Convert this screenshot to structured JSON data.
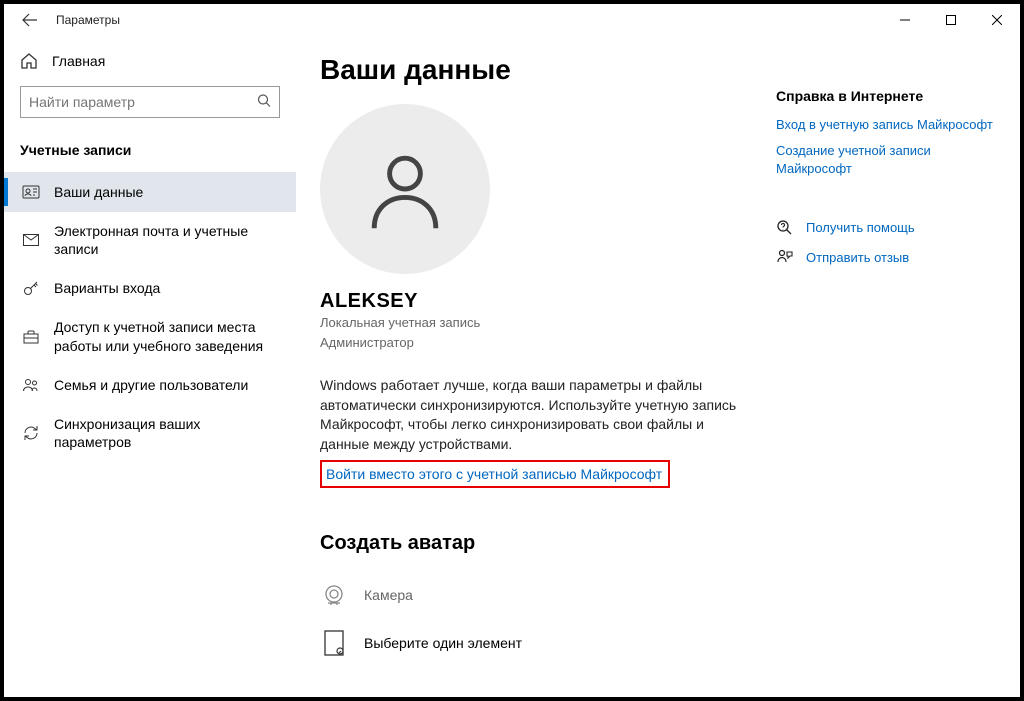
{
  "titlebar": {
    "title": "Параметры"
  },
  "sidebar": {
    "home": "Главная",
    "search_placeholder": "Найти параметр",
    "section": "Учетные записи",
    "items": [
      {
        "label": "Ваши данные"
      },
      {
        "label": "Электронная почта и учетные записи"
      },
      {
        "label": "Варианты входа"
      },
      {
        "label": "Доступ к учетной записи места работы или учебного заведения"
      },
      {
        "label": "Семья и другие пользователи"
      },
      {
        "label": "Синхронизация ваших параметров"
      }
    ]
  },
  "main": {
    "title": "Ваши данные",
    "username": "ALEKSEY",
    "acct_type": "Локальная учетная запись",
    "role": "Администратор",
    "description": "Windows работает лучше, когда ваши параметры и файлы автоматически синхронизируются. Используйте учетную запись Майкрософт, чтобы легко синхронизировать свои файлы и данные между устройствами.",
    "signin_link": "Войти вместо этого с учетной записью Майкрософт",
    "create_avatar_head": "Создать аватар",
    "camera_label": "Камера",
    "browse_label": "Выберите один элемент"
  },
  "right": {
    "help_head": "Справка в Интернете",
    "links": [
      "Вход в учетную запись Майкрософт",
      "Создание учетной записи Майкрософт"
    ],
    "get_help": "Получить помощь",
    "feedback": "Отправить отзыв"
  }
}
